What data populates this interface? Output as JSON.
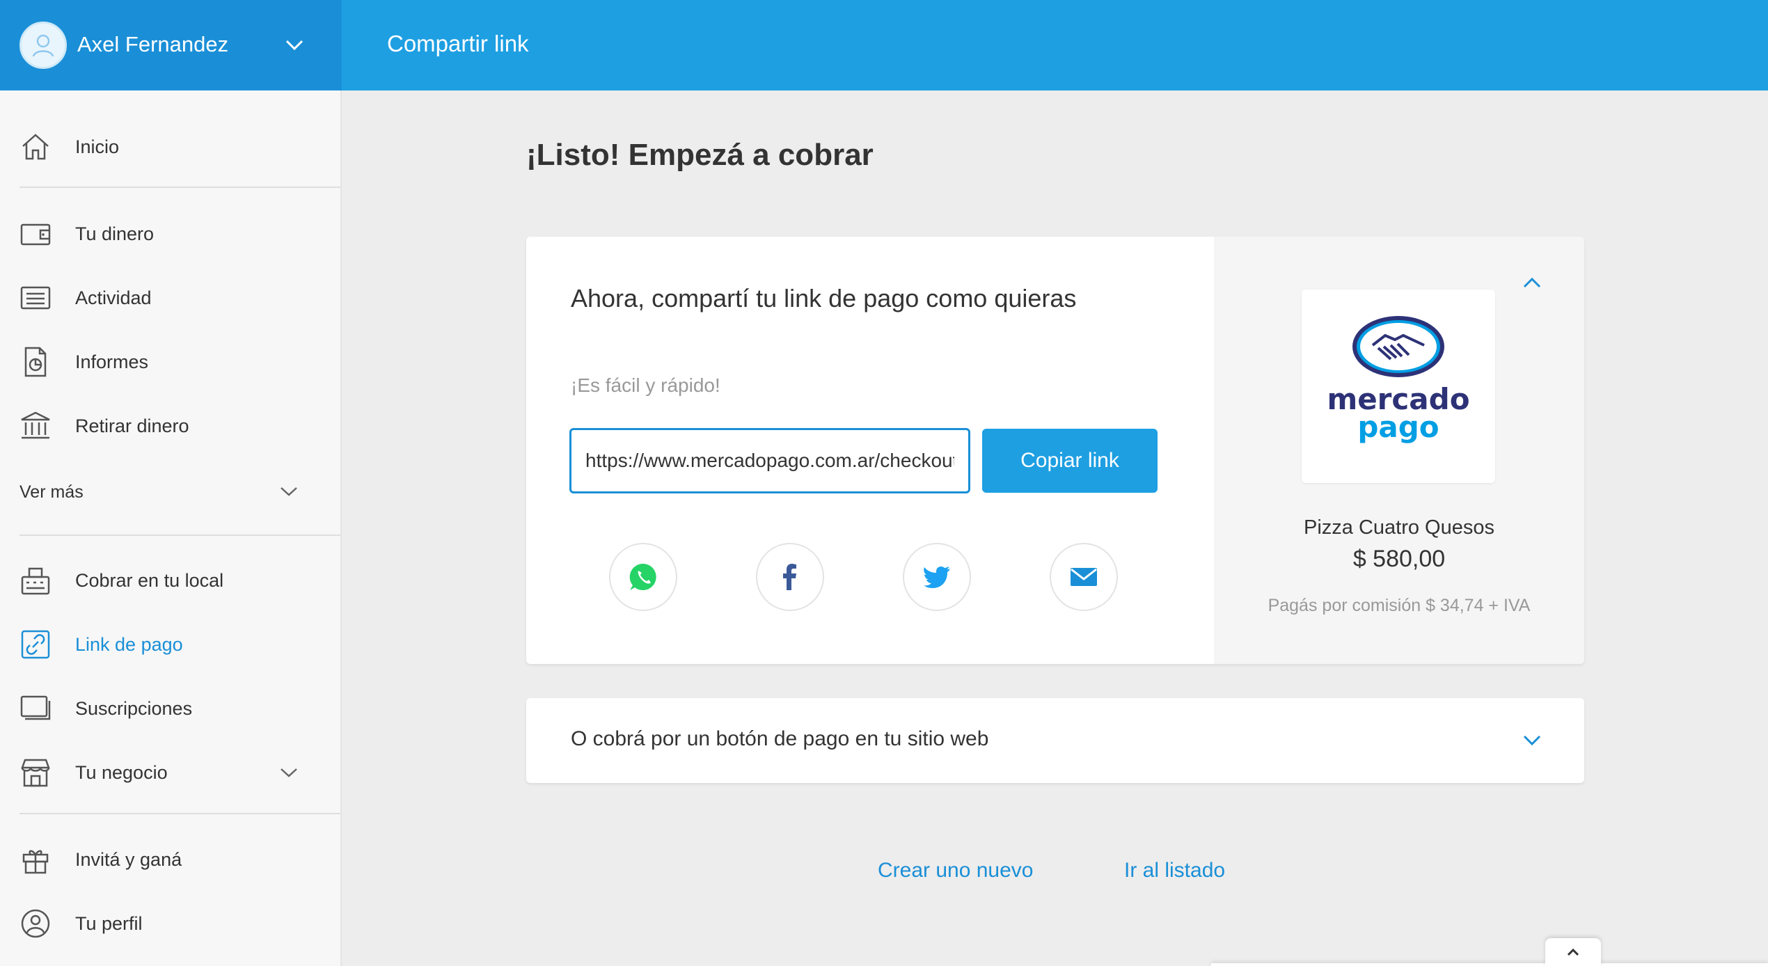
{
  "header": {
    "user_name": "Axel Fernandez",
    "page_title": "Compartir link"
  },
  "sidebar": {
    "items": [
      {
        "label": "Inicio",
        "icon": "home-icon"
      },
      {
        "label": "Tu dinero",
        "icon": "wallet-icon"
      },
      {
        "label": "Actividad",
        "icon": "activity-icon"
      },
      {
        "label": "Informes",
        "icon": "reports-icon"
      },
      {
        "label": "Retirar dinero",
        "icon": "bank-icon"
      },
      {
        "label": "Ver más",
        "icon": "chevron-down-icon"
      },
      {
        "label": "Cobrar en tu local",
        "icon": "cash-register-icon"
      },
      {
        "label": "Link de pago",
        "icon": "link-icon",
        "active": true
      },
      {
        "label": "Suscripciones",
        "icon": "subscriptions-icon"
      },
      {
        "label": "Tu negocio",
        "icon": "store-icon"
      },
      {
        "label": "Invitá y ganá",
        "icon": "gift-icon"
      },
      {
        "label": "Tu perfil",
        "icon": "profile-icon"
      }
    ]
  },
  "main": {
    "heading": "¡Listo! Empezá a cobrar",
    "share": {
      "title": "Ahora, compartí tu link de pago como quieras",
      "subtitle": "¡Es fácil y rápido!",
      "link_value": "https://www.mercadopago.com.ar/checkout",
      "copy_label": "Copiar link",
      "channels": [
        "whatsapp-icon",
        "facebook-icon",
        "twitter-icon",
        "email-icon"
      ]
    },
    "product": {
      "logo_line1": "mercado",
      "logo_line2": "pago",
      "name": "Pizza Cuatro Quesos",
      "price": "$ 580,00",
      "commission": "Pagás por comisión $ 34,74 + IVA"
    },
    "button_section": {
      "label": "O cobrá por un botón de pago en tu sitio web"
    },
    "actions": {
      "create_new": "Crear uno nuevo",
      "go_list": "Ir al listado"
    }
  },
  "colors": {
    "brand_blue": "#1e9fe2",
    "brand_blue_dark": "#1a8fd7",
    "logo_navy": "#2d3277",
    "whatsapp": "#25d366",
    "facebook": "#3b5998",
    "twitter": "#1da1f2"
  }
}
